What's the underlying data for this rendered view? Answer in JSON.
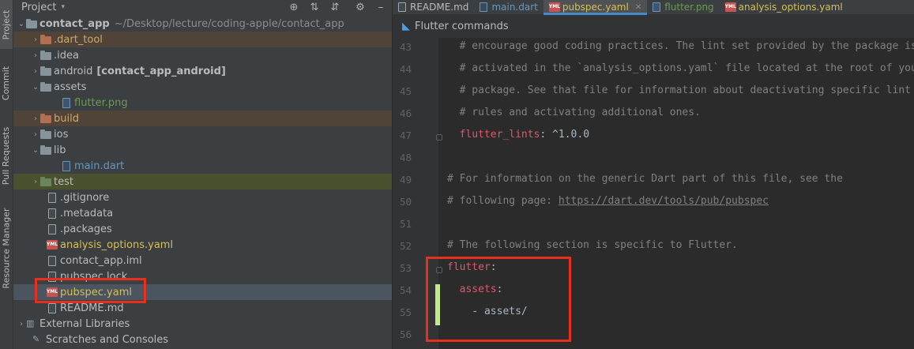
{
  "tool_strip": {
    "tabs": [
      "Project",
      "Commit",
      "Pull Requests",
      "Resource Manager"
    ]
  },
  "project_panel": {
    "title": "Project",
    "dropdown_glyph": "▾",
    "toolbar_icons": [
      "target-icon",
      "collapse-all-icon",
      "expand-all-icon",
      "gear-icon",
      "hide-icon"
    ],
    "root": {
      "name": "contact_app",
      "path": "~/Desktop/lecture/coding-apple/contact_app"
    },
    "tree": [
      {
        "label": ".dart_tool",
        "kind": "folder-orange",
        "arrow": "›"
      },
      {
        "label": ".idea",
        "kind": "folder",
        "arrow": "›"
      },
      {
        "label": "android",
        "suffix": "[contact_app_android]",
        "kind": "folder",
        "arrow": "›"
      },
      {
        "label": "assets",
        "kind": "folder",
        "arrow": "⌄"
      },
      {
        "label": "flutter.png",
        "kind": "file-img"
      },
      {
        "label": "build",
        "kind": "folder-orange",
        "arrow": "›"
      },
      {
        "label": "ios",
        "kind": "folder",
        "arrow": "›"
      },
      {
        "label": "lib",
        "kind": "folder",
        "arrow": "⌄"
      },
      {
        "label": "main.dart",
        "kind": "file-dart"
      },
      {
        "label": "test",
        "kind": "folder-green",
        "arrow": "›"
      },
      {
        "label": ".gitignore",
        "kind": "file"
      },
      {
        "label": ".metadata",
        "kind": "file"
      },
      {
        "label": ".packages",
        "kind": "file"
      },
      {
        "label": "analysis_options.yaml",
        "kind": "yml"
      },
      {
        "label": "contact_app.iml",
        "kind": "file"
      },
      {
        "label": "pubspec.lock",
        "kind": "file"
      },
      {
        "label": "pubspec.yaml",
        "kind": "yml"
      },
      {
        "label": "README.md",
        "kind": "file"
      },
      {
        "label": "External Libraries",
        "kind": "lib"
      },
      {
        "label": "Scratches and Consoles",
        "kind": "scratch"
      }
    ]
  },
  "editor": {
    "tabs": [
      {
        "label": "README.md",
        "active": false
      },
      {
        "label": "main.dart",
        "active": false
      },
      {
        "label": "pubspec.yaml",
        "active": true
      },
      {
        "label": "flutter.png",
        "active": false
      },
      {
        "label": "analysis_options.yaml",
        "active": false
      }
    ],
    "command_bar": "Flutter commands",
    "lines": [
      {
        "n": "43",
        "text": "  # encourage good coding practices. The lint set provided by the package is"
      },
      {
        "n": "44",
        "text": "  # activated in the `analysis_options.yaml` file located at the root of your"
      },
      {
        "n": "45",
        "text": "  # package. See that file for information about deactivating specific lint"
      },
      {
        "n": "46",
        "text": "  # rules and activating additional ones."
      },
      {
        "n": "47",
        "key": "  flutter_lints",
        "val": ": ^1.0.0"
      },
      {
        "n": "48",
        "text": ""
      },
      {
        "n": "49",
        "text": "# For information on the generic Dart part of this file, see the"
      },
      {
        "n": "50",
        "text": "# following page: ",
        "link": "https://dart.dev/tools/pub/pubspec"
      },
      {
        "n": "51",
        "text": ""
      },
      {
        "n": "52",
        "text": "# The following section is specific to Flutter."
      },
      {
        "n": "53",
        "key": "flutter",
        "val": ":"
      },
      {
        "n": "54",
        "key": "  assets",
        "val": ":"
      },
      {
        "n": "55",
        "val": "    - assets/"
      },
      {
        "n": "56",
        "text": ""
      }
    ]
  },
  "colors": {
    "highlight_box": "#e6301d",
    "accent": "#4a88c7"
  }
}
